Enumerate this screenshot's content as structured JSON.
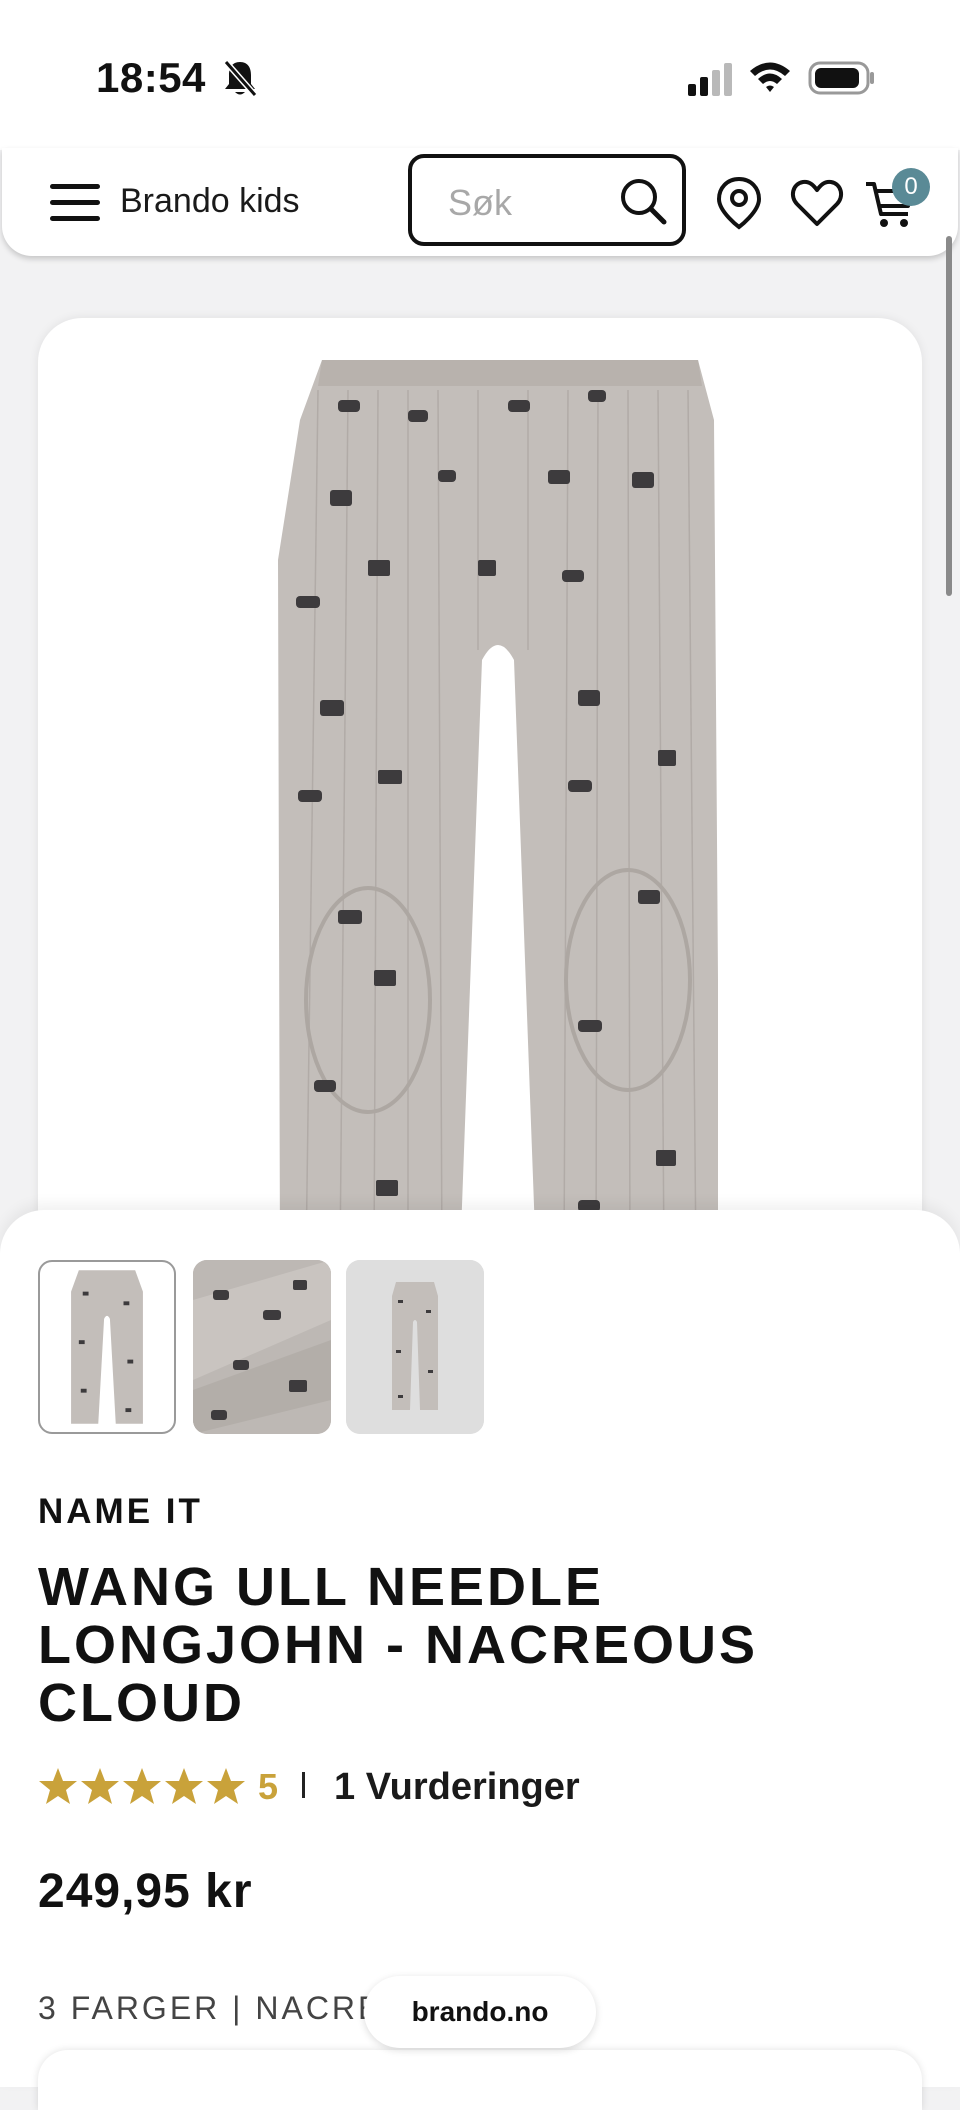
{
  "status_bar": {
    "time": "18:54"
  },
  "header": {
    "brand": "Brando kids",
    "search_placeholder": "Søk",
    "cart_count": "0"
  },
  "gallery": {
    "thumbnails": [
      "thumbnail-front",
      "thumbnail-detail",
      "thumbnail-full"
    ],
    "selected_index": 0
  },
  "product": {
    "brand": "NAME IT",
    "title": "WANG ULL NEEDLE LONGJOHN - NACREOUS CLOUD",
    "rating_value": "5",
    "rating_stars": 5,
    "reviews": "1 Vurderinger",
    "price": "249,95 kr",
    "colors_line": "3 FARGER | NACREO"
  },
  "browser": {
    "url": "brando.no"
  },
  "colors": {
    "accent_star": "#c9a23a",
    "cart_badge": "#5a8a96",
    "fabric": "#c3beba"
  }
}
